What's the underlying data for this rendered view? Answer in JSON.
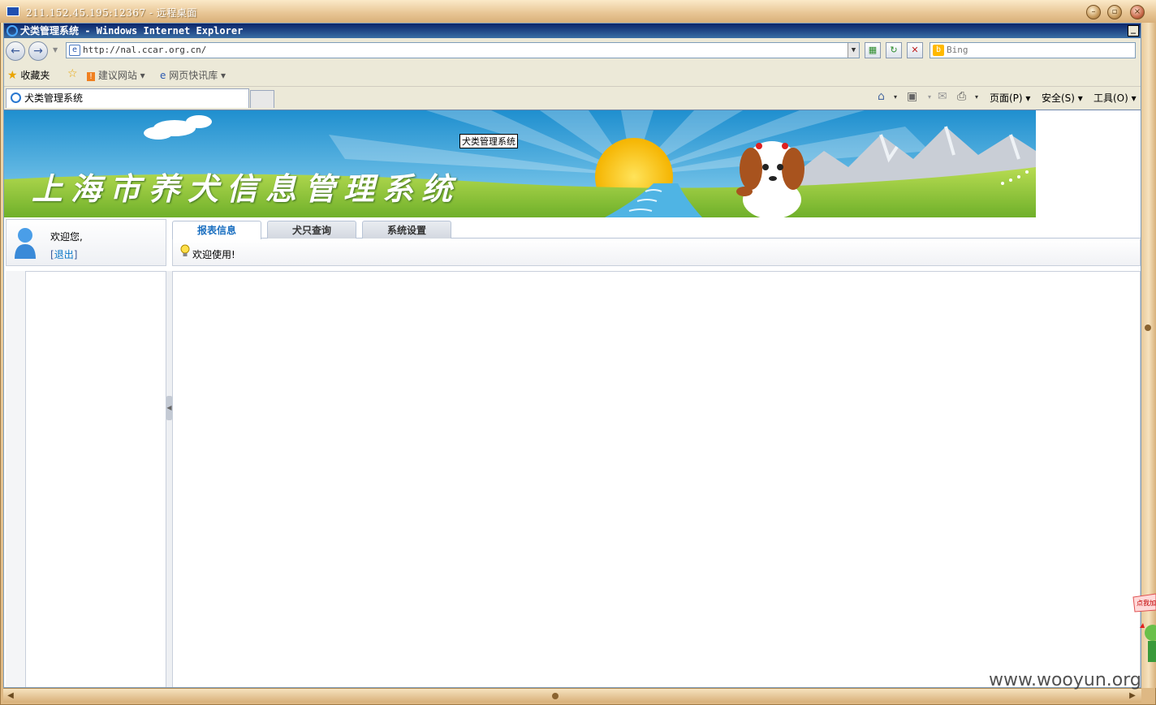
{
  "remote_desktop": {
    "title": "211.152.45.195:12367 - 远程桌面"
  },
  "browser": {
    "window_title": "犬类管理系统 - Windows Internet Explorer",
    "address": "http://nal.ccar.org.cn/",
    "search_placeholder": "Bing",
    "favorites_label": "收藏夹",
    "fav_suggest": "建议网站",
    "fav_webslice": "网页快讯库",
    "tab_title": "犬类管理系统",
    "cmd_page": "页面(P)",
    "cmd_safety": "安全(S)",
    "cmd_tools": "工具(O)"
  },
  "page": {
    "banner_tag": "犬类管理系统",
    "banner_heading": "上海市养犬信息管理系统",
    "welcome": "欢迎您,",
    "logout_open": "[",
    "logout_label": "退出",
    "logout_close": "]",
    "tabs": [
      {
        "label": "报表信息",
        "active": true
      },
      {
        "label": "犬只查询",
        "active": false
      },
      {
        "label": "系统设置",
        "active": false
      }
    ],
    "notice": "欢迎使用!"
  },
  "overlay": {
    "watermark": "www.wooyun.org",
    "widget_text": "点我加"
  },
  "colors": {
    "accent": "#1a6fc0",
    "sky": "#3aa6d8",
    "grass": "#8cc63f"
  }
}
